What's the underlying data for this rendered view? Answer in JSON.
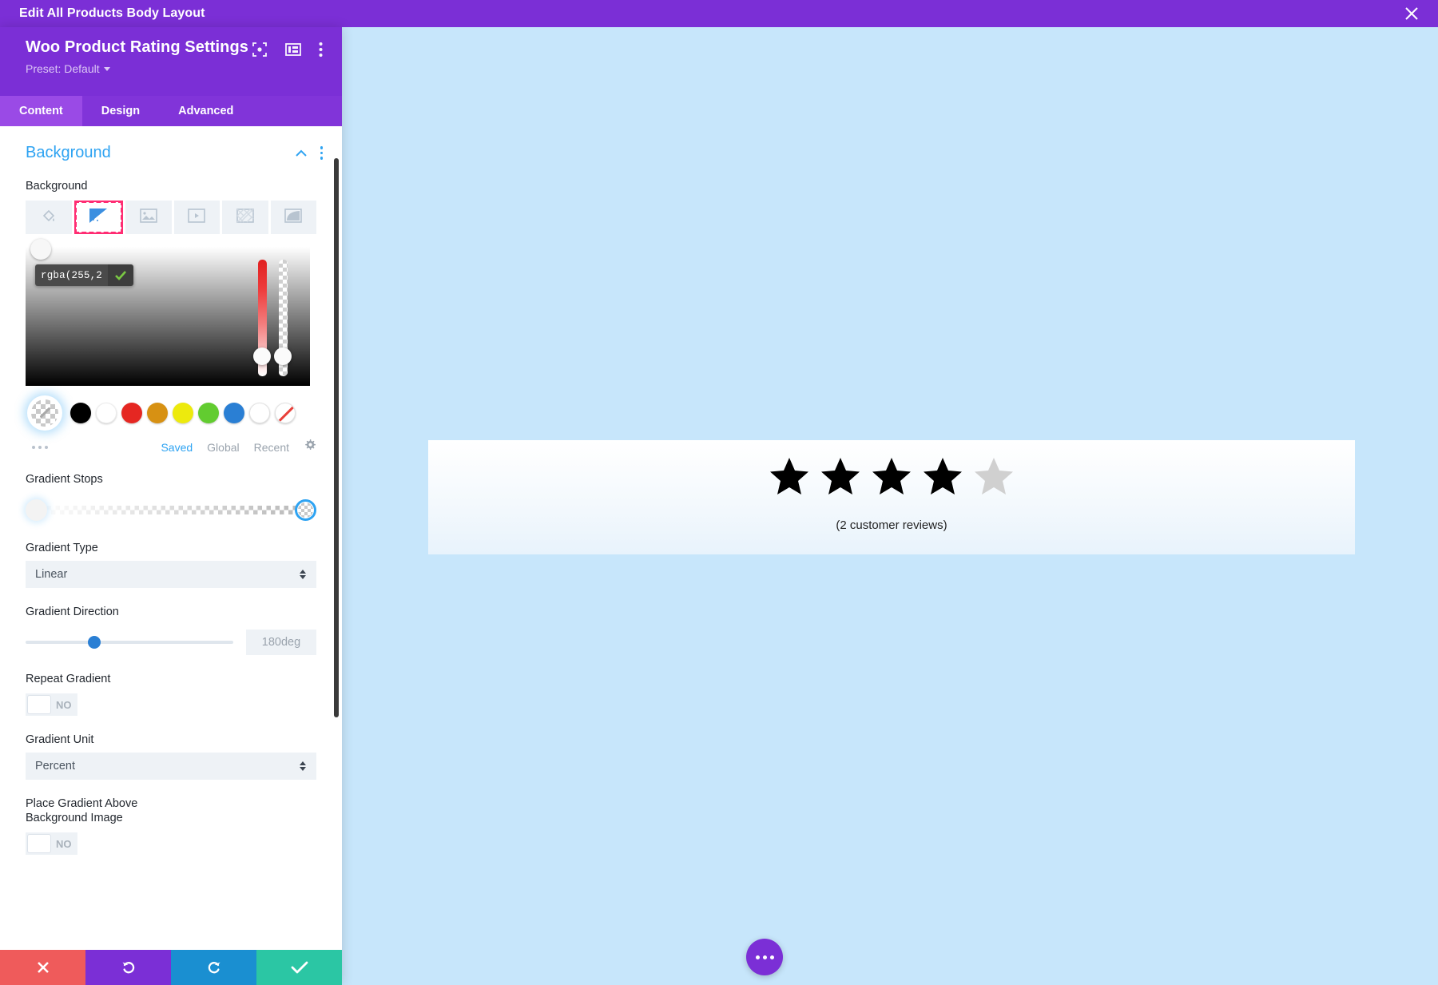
{
  "topbar": {
    "title": "Edit All Products Body Layout",
    "close_icon": "close-icon"
  },
  "panel": {
    "module_title": "Woo Product Rating Settings",
    "header_icons": [
      "target-focus-icon",
      "layout-columns-icon",
      "kebab-menu-icon"
    ],
    "preset_label": "Preset: Default",
    "tabs": [
      {
        "label": "Content",
        "active": true
      },
      {
        "label": "Design",
        "active": false
      },
      {
        "label": "Advanced",
        "active": false
      }
    ],
    "section": {
      "title": "Background",
      "collapse_icon": "chevron-up-icon",
      "options_icon": "kebab-menu-icon"
    },
    "background": {
      "label": "Background",
      "types": [
        {
          "name": "background-color",
          "icon": "paint-bucket-icon",
          "selected": false
        },
        {
          "name": "background-gradient",
          "icon": "gradient-icon",
          "selected": true
        },
        {
          "name": "background-image",
          "icon": "image-icon",
          "selected": false
        },
        {
          "name": "background-video",
          "icon": "video-icon",
          "selected": false
        },
        {
          "name": "background-pattern",
          "icon": "pattern-icon",
          "selected": false
        },
        {
          "name": "background-mask",
          "icon": "mask-icon",
          "selected": false
        }
      ]
    },
    "color_picker": {
      "tooltip_value": "rgba(255,2",
      "confirm_icon": "green-check-icon",
      "swatches": [
        {
          "name": "transparent",
          "color": "transparent",
          "selected": true
        },
        {
          "name": "black",
          "color": "#000000",
          "selected": false
        },
        {
          "name": "white",
          "color": "#ffffff",
          "selected": false
        },
        {
          "name": "red",
          "color": "#e52722",
          "selected": false
        },
        {
          "name": "orange",
          "color": "#d79113",
          "selected": false
        },
        {
          "name": "yellow",
          "color": "#edea0d",
          "selected": false
        },
        {
          "name": "green",
          "color": "#62cc30",
          "selected": false
        },
        {
          "name": "blue",
          "color": "#2a7fd4",
          "selected": false
        },
        {
          "name": "white-outline",
          "color": "#ffffff",
          "selected": false
        },
        {
          "name": "none",
          "color": "none",
          "selected": false
        }
      ],
      "more_icon": "ellipsis-icon",
      "tabs": [
        {
          "label": "Saved",
          "active": true
        },
        {
          "label": "Global",
          "active": false
        },
        {
          "label": "Recent",
          "active": false
        }
      ],
      "settings_icon": "gear-icon"
    },
    "gradient_stops": {
      "label": "Gradient Stops"
    },
    "gradient_type": {
      "label": "Gradient Type",
      "value": "Linear"
    },
    "gradient_direction": {
      "label": "Gradient Direction",
      "value": "180deg",
      "slider_percent": 33
    },
    "repeat_gradient": {
      "label": "Repeat Gradient",
      "value": "NO"
    },
    "gradient_unit": {
      "label": "Gradient Unit",
      "value": "Percent"
    },
    "place_gradient_above": {
      "label_line1": "Place Gradient Above",
      "label_line2": "Background Image",
      "value": "NO"
    },
    "actions": [
      {
        "name": "cancel-button",
        "icon": "x-icon",
        "color": "#ef5b5b"
      },
      {
        "name": "undo-button",
        "icon": "undo-icon",
        "color": "#7b2fd6"
      },
      {
        "name": "redo-button",
        "icon": "redo-icon",
        "color": "#1a8fd1"
      },
      {
        "name": "save-button",
        "icon": "check-icon",
        "color": "#2bc6a4"
      }
    ]
  },
  "preview": {
    "rating": {
      "filled": 4,
      "total": 5,
      "filled_color": "#000000",
      "empty_color": "#d0d0d0"
    },
    "review_count_text": "(2 customer reviews)",
    "fab_icon": "ellipsis-icon",
    "canvas_color": "#c7e6fb"
  }
}
